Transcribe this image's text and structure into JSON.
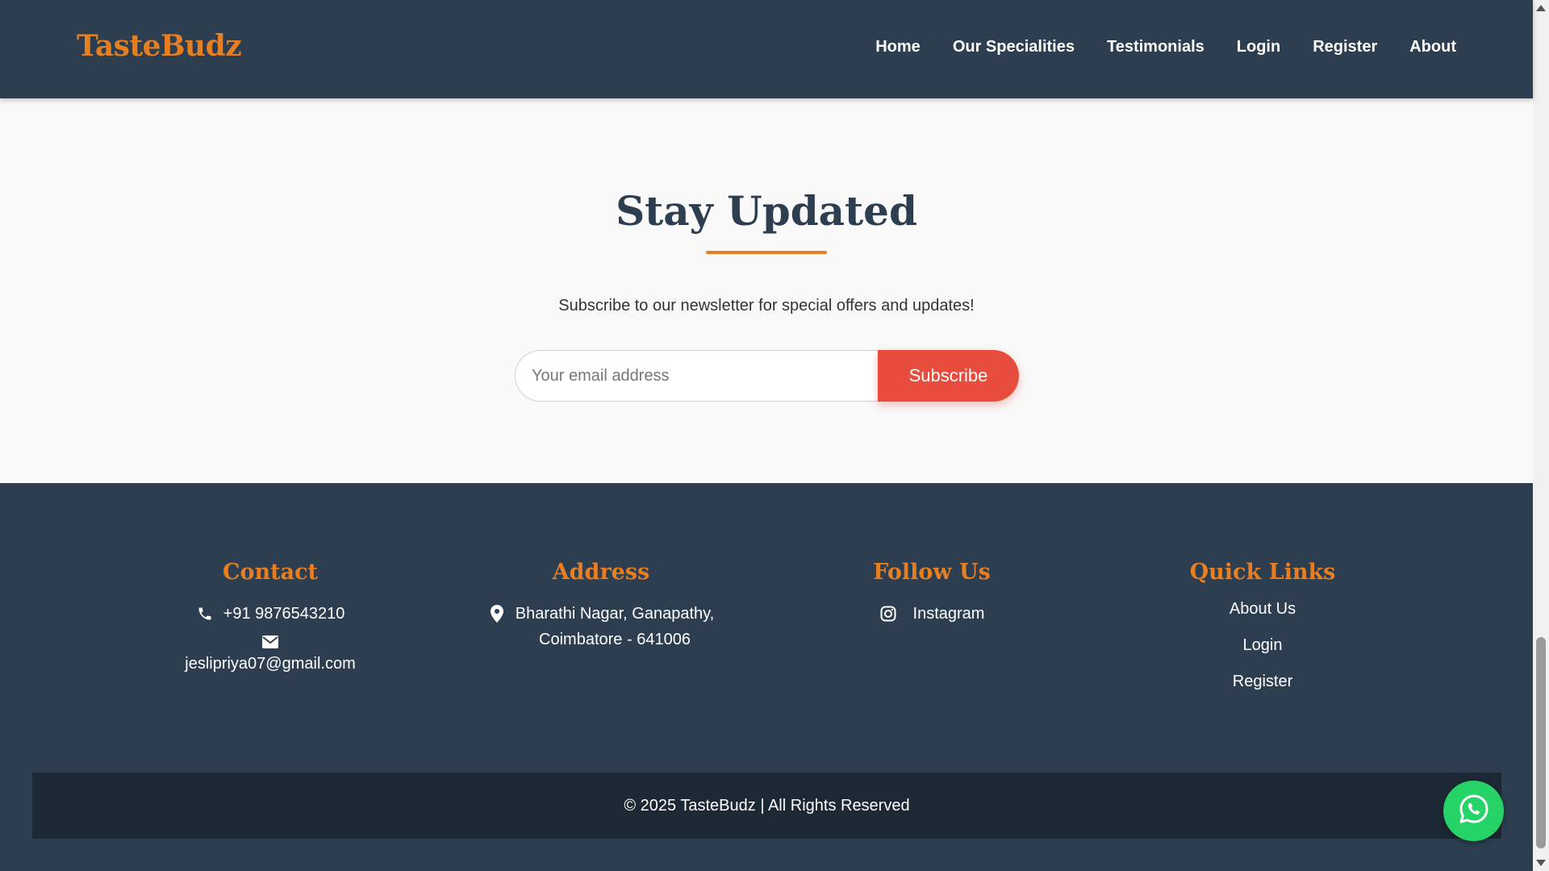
{
  "header": {
    "logo": "TasteBudz",
    "nav": [
      "Home",
      "Our Specialities",
      "Testimonials",
      "Login",
      "Register",
      "About"
    ]
  },
  "newsletter": {
    "title": "Stay Updated",
    "text": "Subscribe to our newsletter for special offers and updates!",
    "email_placeholder": "Your email address",
    "button_label": "Subscribe"
  },
  "footer": {
    "contact": {
      "title": "Contact",
      "phone": "+91 9876543210",
      "email": "jeslipriya07@gmail.com",
      "phone_icon": "phone-icon",
      "email_icon": "envelope-icon"
    },
    "address": {
      "title": "Address",
      "line1": "Bharathi Nagar, Ganapathy,",
      "line2": "Coimbatore - 641006",
      "icon": "map-pin-icon"
    },
    "follow": {
      "title": "Follow Us",
      "instagram": "Instagram",
      "icon": "instagram-icon"
    },
    "quick_links": {
      "title": "Quick Links",
      "links": [
        "About Us",
        "Login",
        "Register"
      ]
    },
    "copyright": "© 2025 TasteBudz | All Rights Reserved"
  },
  "floating": {
    "icon": "whatsapp-icon"
  },
  "colors": {
    "header_bg": "#2c3e50",
    "accent": "#e67e22",
    "subscribe_button": "#e74c3c",
    "newsletter_bg": "#f9f9f9",
    "copyright_bg": "#1c2833",
    "whatsapp": "#25d366"
  }
}
